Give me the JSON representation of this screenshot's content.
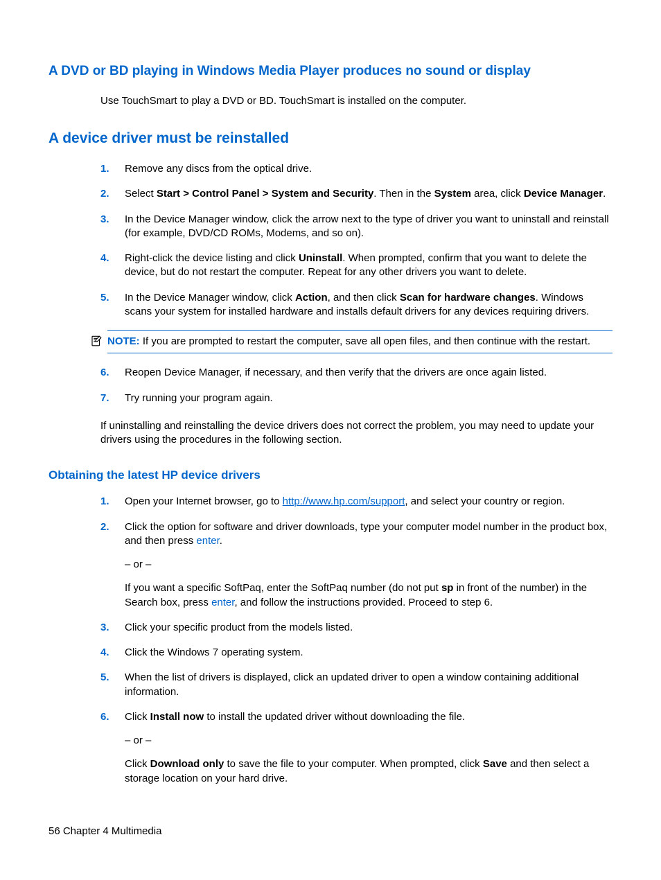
{
  "heading1": "A DVD or BD playing in Windows Media Player produces no sound or display",
  "intro1": "Use TouchSmart to play a DVD or BD. TouchSmart is installed on the computer.",
  "heading2": "A device driver must be reinstalled",
  "list1": {
    "n1": "1.",
    "t1": "Remove any discs from the optical drive.",
    "n2": "2.",
    "t2a": "Select ",
    "t2b": "Start > Control Panel > System and Security",
    "t2c": ". Then in the ",
    "t2d": "System",
    "t2e": " area, click ",
    "t2f": "Device Manager",
    "t2g": ".",
    "n3": "3.",
    "t3": "In the Device Manager window, click the arrow next to the type of driver you want to uninstall and reinstall (for example, DVD/CD ROMs, Modems, and so on).",
    "n4": "4.",
    "t4a": "Right-click the device listing and click ",
    "t4b": "Uninstall",
    "t4c": ". When prompted, confirm that you want to delete the device, but do not restart the computer. Repeat for any other drivers you want to delete.",
    "n5": "5.",
    "t5a": "In the Device Manager window, click ",
    "t5b": "Action",
    "t5c": ", and then click ",
    "t5d": "Scan for hardware changes",
    "t5e": ". Windows scans your system for installed hardware and installs default drivers for any devices requiring drivers.",
    "n6": "6.",
    "t6": "Reopen Device Manager, if necessary, and then verify that the drivers are once again listed.",
    "n7": "7.",
    "t7": "Try running your program again."
  },
  "note_label": "NOTE:",
  "note_text": "If you are prompted to restart the computer, save all open files, and then continue with the restart.",
  "post1": "If uninstalling and reinstalling the device drivers does not correct the problem, you may need to update your drivers using the procedures in the following section.",
  "heading3": "Obtaining the latest HP device drivers",
  "list2": {
    "n1": "1.",
    "t1a": "Open your Internet browser, go to ",
    "t1link": "http://www.hp.com/support",
    "t1b": ", and select your country or region.",
    "n2": "2.",
    "t2a": "Click the option for software and driver downloads, type your computer model number in the product box, and then press ",
    "t2key": "enter",
    "t2b": ".",
    "t2or": "– or –",
    "t2c": "If you want a specific SoftPaq, enter the SoftPaq number (do not put ",
    "t2sp": "sp",
    "t2d": " in front of the number) in the Search box, press ",
    "t2key2": "enter",
    "t2e": ", and follow the instructions provided. Proceed to step 6.",
    "n3": "3.",
    "t3": "Click your specific product from the models listed.",
    "n4": "4.",
    "t4": "Click the Windows 7 operating system.",
    "n5": "5.",
    "t5": "When the list of drivers is displayed, click an updated driver to open a window containing additional information.",
    "n6": "6.",
    "t6a": "Click ",
    "t6b": "Install now",
    "t6c": " to install the updated driver without downloading the file.",
    "t6or": "– or –",
    "t6d": "Click ",
    "t6e": "Download only",
    "t6f": " to save the file to your computer. When prompted, click ",
    "t6g": "Save",
    "t6h": " and then select a storage location on your hard drive."
  },
  "footer": "56    Chapter 4   Multimedia"
}
